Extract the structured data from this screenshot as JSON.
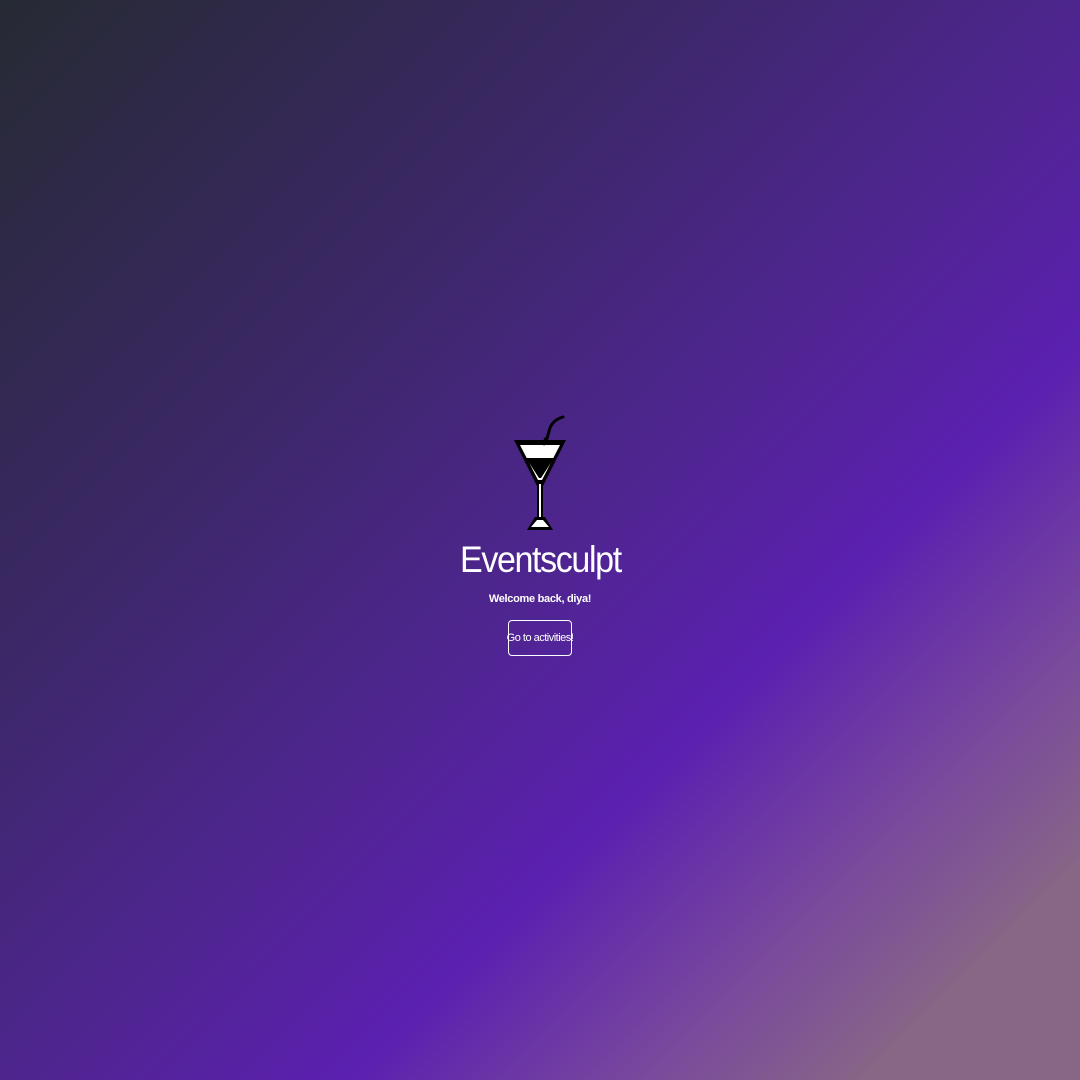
{
  "app": {
    "title": "Eventsculpt",
    "logo_icon": "cocktail-glass-icon"
  },
  "welcome": {
    "message": "Welcome back, diya!"
  },
  "actions": {
    "go_to_activities_label": "Go to activities!"
  },
  "colors": {
    "gradient_start": "#262a33",
    "gradient_mid": "#5b20b0",
    "gradient_end": "#876686",
    "text": "#ffffff"
  }
}
